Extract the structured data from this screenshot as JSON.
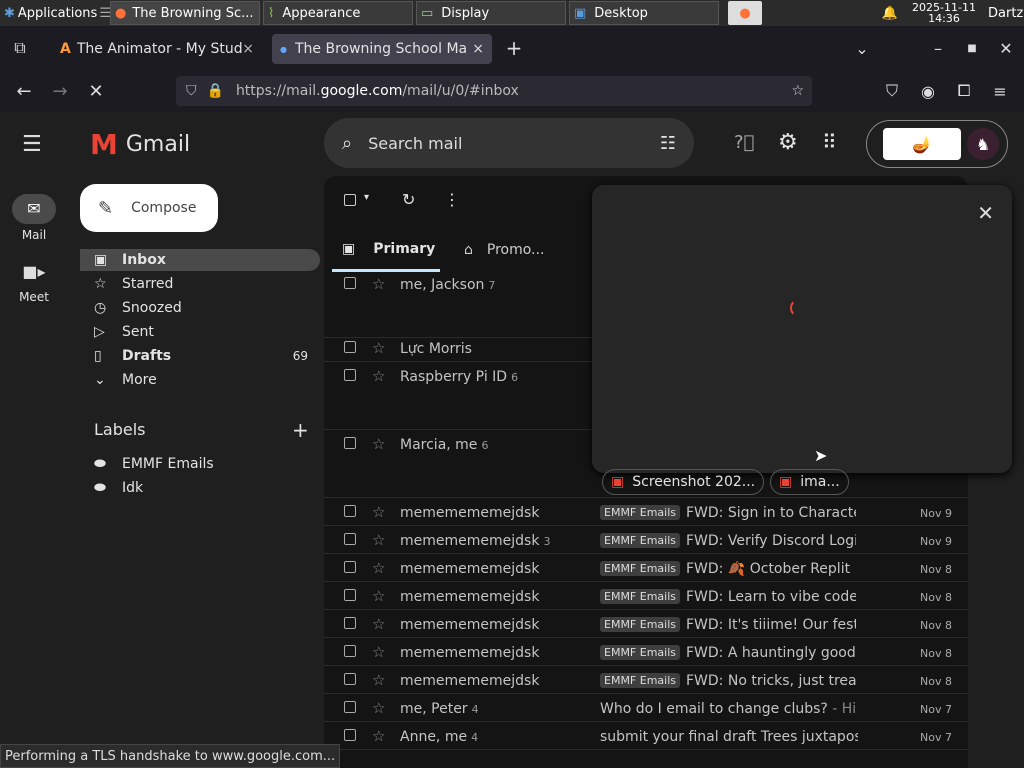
{
  "taskbar": {
    "apps_label": "Applications",
    "tasks": [
      "The Browning Sc...",
      "Appearance",
      "Display",
      "Desktop"
    ],
    "datetime_date": "2025-11-11",
    "datetime_time": "14:36",
    "user": "Dartz"
  },
  "browser": {
    "tabs": [
      {
        "title": "The Animator - My Studio"
      },
      {
        "title": "The Browning School Ma"
      }
    ],
    "url_prefix": "https://mail.",
    "url_domain": "google.com",
    "url_suffix": "/mail/u/0/#inbox"
  },
  "gmail": {
    "logo_text": "Gmail",
    "search_placeholder": "Search mail",
    "compose_label": "Compose",
    "rail": [
      {
        "label": "Mail"
      },
      {
        "label": "Meet"
      }
    ],
    "nav": [
      {
        "label": "Inbox",
        "count": ""
      },
      {
        "label": "Starred",
        "count": ""
      },
      {
        "label": "Snoozed",
        "count": ""
      },
      {
        "label": "Sent",
        "count": ""
      },
      {
        "label": "Drafts",
        "count": "69"
      },
      {
        "label": "More",
        "count": ""
      }
    ],
    "labels_heading": "Labels",
    "labels": [
      "EMMF Emails",
      "Idk"
    ],
    "inbox_tabs": [
      "Primary",
      "Promo..."
    ],
    "emails": [
      {
        "sender": "me, Jackson",
        "count": "7",
        "label": "",
        "subject": "",
        "date": ""
      },
      {
        "sender": "Lực Morris",
        "count": "",
        "label": "",
        "subject": "",
        "date": ""
      },
      {
        "sender": "Raspberry Pi ID",
        "count": "6",
        "label": "",
        "subject": "",
        "date": ""
      },
      {
        "sender": "Marcia, me",
        "count": "6",
        "label": "",
        "subject": "",
        "date": ""
      },
      {
        "sender": "mememememejdsk",
        "count": "",
        "label": "EMMF Emails",
        "subject": "FWD: Sign in to Characte...",
        "date": "Nov 9"
      },
      {
        "sender": "mememememejdsk",
        "count": "3",
        "label": "EMMF Emails",
        "subject": "FWD: Verify Discord Logi...",
        "date": "Nov 9"
      },
      {
        "sender": "mememememejdsk",
        "count": "",
        "label": "EMMF Emails",
        "subject": "FWD: 🍂 October Replit ...",
        "date": "Nov 8"
      },
      {
        "sender": "mememememejdsk",
        "count": "",
        "label": "EMMF Emails",
        "subject": "FWD: Learn to vibe code ...",
        "date": "Nov 8"
      },
      {
        "sender": "mememememejdsk",
        "count": "",
        "label": "EMMF Emails",
        "subject": "FWD: It's tiiime! Our festi...",
        "date": "Nov 8"
      },
      {
        "sender": "mememememejdsk",
        "count": "",
        "label": "EMMF Emails",
        "subject": "FWD: A hauntingly good ...",
        "date": "Nov 8"
      },
      {
        "sender": "mememememejdsk",
        "count": "",
        "label": "EMMF Emails",
        "subject": "FWD: No tricks, just treat...",
        "date": "Nov 8"
      },
      {
        "sender": "me, Peter",
        "count": "4",
        "label": "",
        "subject": "Who do I email to change clubs?",
        "snippet": " - Hi J...",
        "date": "Nov 7"
      },
      {
        "sender": "Anne, me",
        "count": "4",
        "label": "",
        "subject": "submit your final draft Trees juxtapositi...",
        "date": "Nov 7"
      }
    ],
    "attachments": [
      "Screenshot 202...",
      "ima..."
    ]
  },
  "status_text": "Performing a TLS handshake to www.google.com...",
  "colors": {
    "accent": "#c2e7ff",
    "gmail_red": "#ea4335"
  }
}
